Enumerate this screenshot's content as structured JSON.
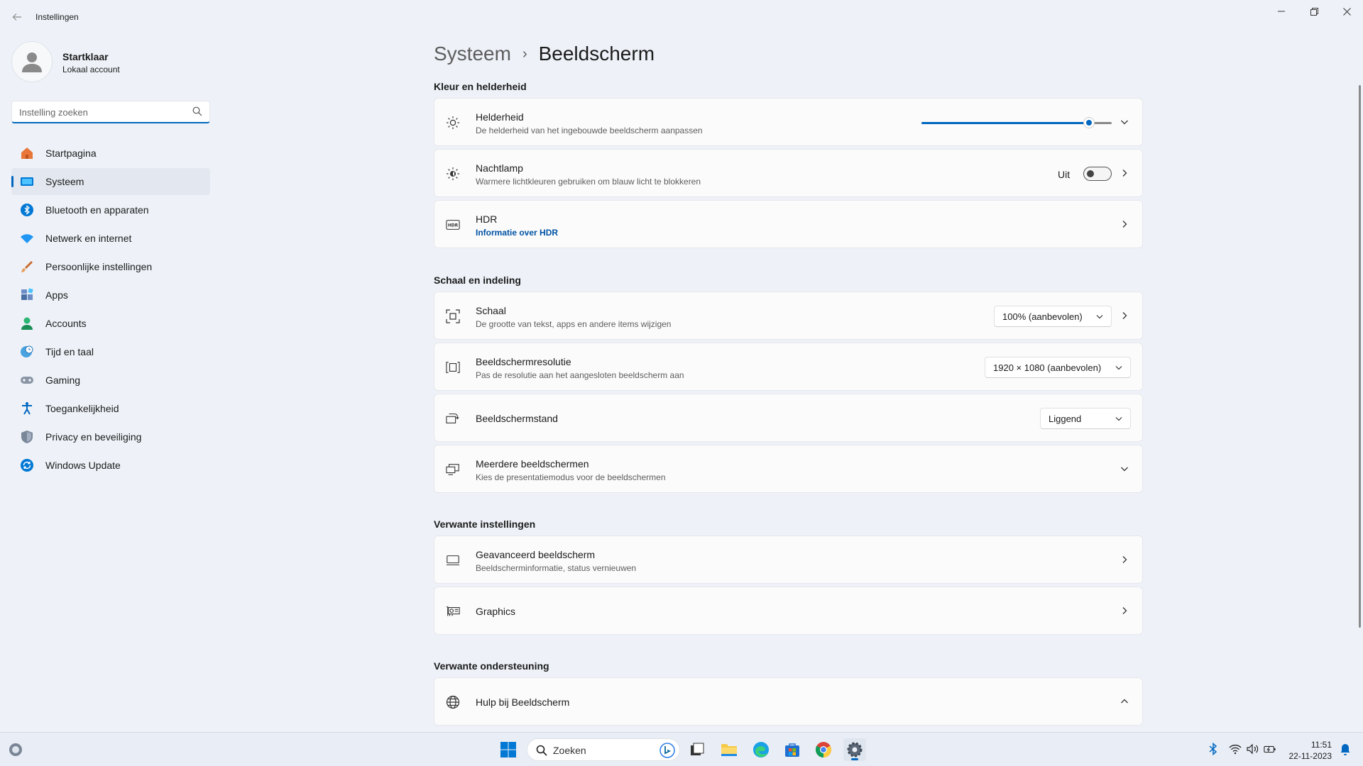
{
  "window": {
    "title": "Instellingen",
    "minimize": "—",
    "maximize": "❐",
    "close": "✕"
  },
  "profile": {
    "name": "Startklaar",
    "account_type": "Lokaal account"
  },
  "search": {
    "placeholder": "Instelling zoeken",
    "value": ""
  },
  "sidebar": {
    "items": [
      {
        "label": "Startpagina",
        "icon": "home-icon"
      },
      {
        "label": "Systeem",
        "icon": "system-icon",
        "active": true
      },
      {
        "label": "Bluetooth en apparaten",
        "icon": "bluetooth-icon"
      },
      {
        "label": "Netwerk en internet",
        "icon": "wifi-icon"
      },
      {
        "label": "Persoonlijke instellingen",
        "icon": "brush-icon"
      },
      {
        "label": "Apps",
        "icon": "apps-icon"
      },
      {
        "label": "Accounts",
        "icon": "accounts-icon"
      },
      {
        "label": "Tijd en taal",
        "icon": "globe-clock-icon"
      },
      {
        "label": "Gaming",
        "icon": "gamepad-icon"
      },
      {
        "label": "Toegankelijkheid",
        "icon": "accessibility-icon"
      },
      {
        "label": "Privacy en beveiliging",
        "icon": "shield-icon"
      },
      {
        "label": "Windows Update",
        "icon": "update-icon"
      }
    ]
  },
  "breadcrumb": {
    "parent": "Systeem",
    "separator": "›",
    "current": "Beeldscherm"
  },
  "sections": {
    "kleur": {
      "title": "Kleur en helderheid",
      "helderheid": {
        "title": "Helderheid",
        "subtitle": "De helderheid van het ingebouwde beeldscherm aanpassen",
        "brightness_fraction": 0.88
      },
      "nachtlamp": {
        "title": "Nachtlamp",
        "subtitle": "Warmere lichtkleuren gebruiken om blauw licht te blokkeren",
        "state_label": "Uit",
        "on": false
      },
      "hdr": {
        "title": "HDR",
        "link": "Informatie over HDR"
      }
    },
    "schaal": {
      "title": "Schaal en indeling",
      "schaal": {
        "title": "Schaal",
        "subtitle": "De grootte van tekst, apps en andere items wijzigen",
        "value": "100% (aanbevolen)"
      },
      "resolutie": {
        "title": "Beeldschermresolutie",
        "subtitle": "Pas de resolutie aan het aangesloten beeldscherm aan",
        "value": "1920 × 1080 (aanbevolen)"
      },
      "stand": {
        "title": "Beeldschermstand",
        "value": "Liggend"
      },
      "meerdere": {
        "title": "Meerdere beeldschermen",
        "subtitle": "Kies de presentatiemodus voor de beeldschermen"
      }
    },
    "verwant": {
      "title": "Verwante instellingen",
      "geavanceerd": {
        "title": "Geavanceerd beeldscherm",
        "subtitle": "Beeldscherminformatie, status vernieuwen"
      },
      "graphics": {
        "title": "Graphics"
      }
    },
    "ondersteuning": {
      "title": "Verwante ondersteuning",
      "hulp": {
        "title": "Hulp bij Beeldscherm"
      }
    }
  },
  "taskbar": {
    "search_label": "Zoeken",
    "time": "11:51",
    "date": "22-11-2023"
  },
  "colors": {
    "accent": "#0067c0",
    "background": "#eef2f8",
    "card": "#fbfbfc"
  }
}
